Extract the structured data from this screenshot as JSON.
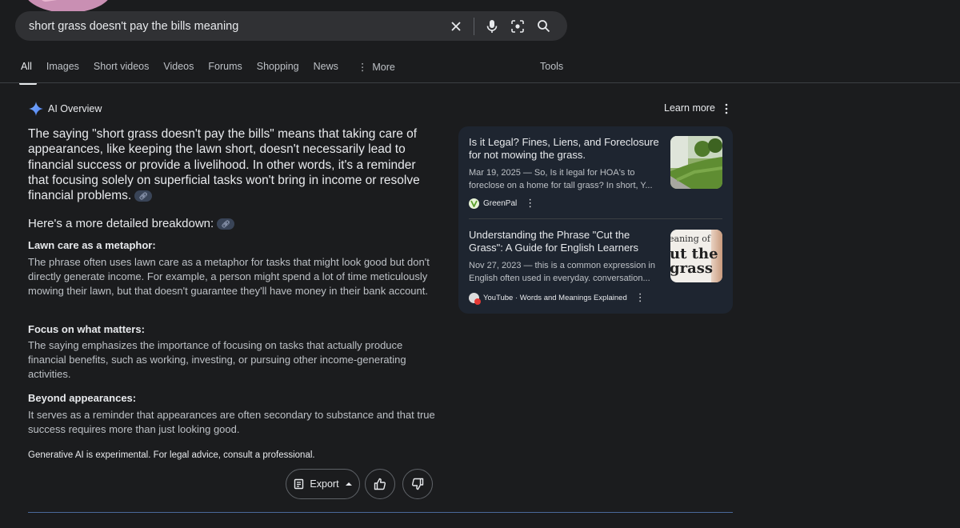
{
  "search": {
    "query": "short grass doesn't pay the bills meaning"
  },
  "tabs": [
    "All",
    "Images",
    "Short videos",
    "Videos",
    "Forums",
    "Shopping",
    "News",
    "More"
  ],
  "tools_label": "Tools",
  "overview": {
    "label": "AI Overview",
    "learn_more": "Learn more",
    "lead": "The saying \"short grass doesn't pay the bills\" means that taking care of appearances, like keeping the lawn short, doesn't necessarily lead to financial success or provide a livelihood. In other words, it's a reminder that focusing solely on superficial tasks won't bring in income or resolve financial problems.",
    "breakdown_heading": "Here's a more detailed breakdown:",
    "sections": [
      {
        "heading": "Lawn care as a metaphor:",
        "body": "The phrase often uses lawn care as a metaphor for tasks that might look good but don't directly generate income. For example, a person might spend a lot of time meticulously mowing their lawn, but that doesn't guarantee they'll have money in their bank account."
      },
      {
        "heading": "Focus on what matters:",
        "body": "The saying emphasizes the importance of focusing on tasks that actually produce financial benefits, such as working, investing, or pursuing other income-generating activities."
      },
      {
        "heading": "Beyond appearances:",
        "body": "It serves as a reminder that appearances are often secondary to substance and that true success requires more than just looking good."
      }
    ],
    "disclaimer": "Generative AI is experimental. For legal advice, consult a professional.",
    "export_label": "Export"
  },
  "sources": [
    {
      "title": "Is it Legal? Fines, Liens, and Foreclosure for not mowing the grass.",
      "snippet": "Mar 19, 2025 — So, Is it legal for HOA's to foreclose on a home for tall grass? In short, Y...",
      "site": "GreenPal"
    },
    {
      "title": "Understanding the Phrase \"Cut the Grass\": A Guide for English Learners",
      "snippet": "Nov 27, 2023 — this is a common expression in English often used in everyday. conversation...",
      "site": "YouTube · Words and Meanings Explained",
      "thumb_text_1": "eaning of",
      "thumb_text_2": "ut the",
      "thumb_text_3": "grass"
    }
  ],
  "colors": {
    "accent_line": "#4a6a9a",
    "chip": "#394457"
  }
}
